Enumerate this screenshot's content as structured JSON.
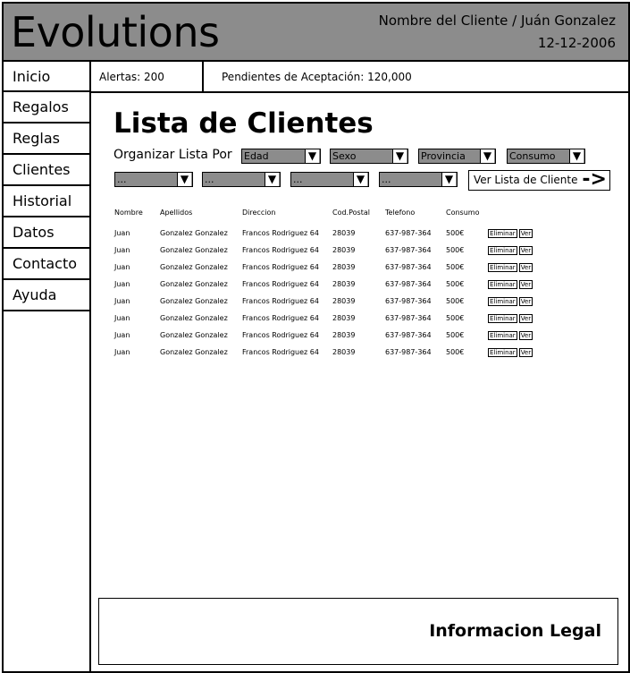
{
  "header": {
    "app_title": "Evolutions",
    "client_name": "Nombre del Cliente / Juán Gonzalez",
    "date": "12-12-2006"
  },
  "sidebar": {
    "items": [
      {
        "label": "Inicio"
      },
      {
        "label": "Regalos"
      },
      {
        "label": "Reglas"
      },
      {
        "label": "Clientes"
      },
      {
        "label": "Historial"
      },
      {
        "label": "Datos"
      },
      {
        "label": "Contacto"
      },
      {
        "label": "Ayuda"
      }
    ]
  },
  "statusbar": {
    "alerts": "Alertas: 200",
    "pending": "Pendientes de Aceptación: 120,000"
  },
  "main": {
    "title": "Lista de Clientes",
    "sort_label": "Organizar Lista Por",
    "filters_row1": [
      "Edad",
      "Sexo",
      "Provincia",
      "Consumo"
    ],
    "filters_row2": [
      "...",
      "...",
      "...",
      "..."
    ],
    "view_button_label": "Ver Lista de Cliente",
    "view_button_arrow": "->"
  },
  "table": {
    "headers": [
      "Nombre",
      "Apellidos",
      "Direccion",
      "Cod.Postal",
      "Telefono",
      "Consumo"
    ],
    "rows": [
      [
        "Juan",
        "Gonzalez Gonzalez",
        "Francos Rodriguez 64",
        "28039",
        "637-987-364",
        "500€"
      ],
      [
        "Juan",
        "Gonzalez Gonzalez",
        "Francos Rodriguez 64",
        "28039",
        "637-987-364",
        "500€"
      ],
      [
        "Juan",
        "Gonzalez Gonzalez",
        "Francos Rodriguez 64",
        "28039",
        "637-987-364",
        "500€"
      ],
      [
        "Juan",
        "Gonzalez Gonzalez",
        "Francos Rodriguez 64",
        "28039",
        "637-987-364",
        "500€"
      ],
      [
        "Juan",
        "Gonzalez Gonzalez",
        "Francos Rodriguez 64",
        "28039",
        "637-987-364",
        "500€"
      ],
      [
        "Juan",
        "Gonzalez Gonzalez",
        "Francos Rodriguez 64",
        "28039",
        "637-987-364",
        "500€"
      ],
      [
        "Juan",
        "Gonzalez Gonzalez",
        "Francos Rodriguez 64",
        "28039",
        "637-987-364",
        "500€"
      ],
      [
        "Juan",
        "Gonzalez Gonzalez",
        "Francos Rodriguez 64",
        "28039",
        "637-987-364",
        "500€"
      ]
    ],
    "delete_label": "Eliminar",
    "view_label": "Ver"
  },
  "footer": {
    "legal": "Informacion Legal"
  },
  "colors": {
    "header_bg": "#8c8c8c",
    "select_bg": "#8c8c8c",
    "border": "#000000"
  }
}
